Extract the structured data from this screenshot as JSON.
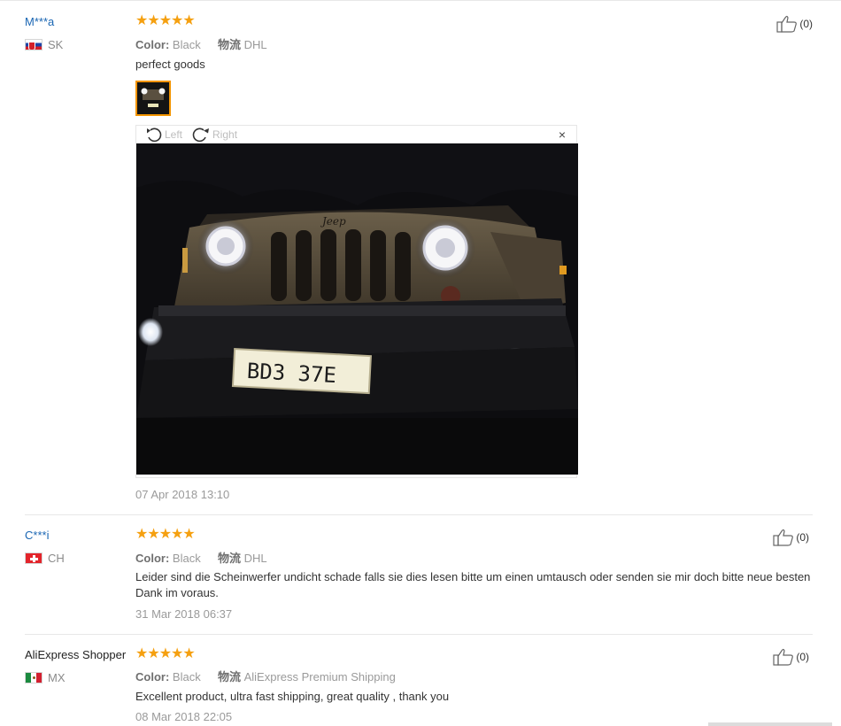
{
  "reviews": [
    {
      "name": "M***a",
      "country": "SK",
      "flag": "sk",
      "stars": "★★★★★",
      "color_label": "Color:",
      "color_value": "Black",
      "shipping_label": "物流",
      "shipping_value": "DHL",
      "text": "perfect goods",
      "date": "07 Apr 2018 13:10",
      "helpful": "(0)"
    },
    {
      "name": "C***i",
      "country": "CH",
      "flag": "ch",
      "stars": "★★★★★",
      "color_label": "Color:",
      "color_value": "Black",
      "shipping_label": "物流",
      "shipping_value": "DHL",
      "text": "Leider sind die Scheinwerfer undicht schade falls sie dies lesen bitte um einen umtausch oder senden sie mir doch bitte neue besten Dank im voraus.",
      "date": "31 Mar 2018 06:37",
      "helpful": "(0)"
    },
    {
      "name": "AliExpress Shopper",
      "country": "MX",
      "flag": "mx",
      "stars": "★★★★★",
      "color_label": "Color:",
      "color_value": "Black",
      "shipping_label": "物流",
      "shipping_value": "AliExpress Premium Shipping",
      "text": "Excellent product, ultra fast shipping, great quality , thank you",
      "date": "08 Mar 2018 22:05",
      "helpful": "(0)"
    }
  ],
  "viewer": {
    "rotate_left": "Left",
    "rotate_right": "Right",
    "close": "×",
    "plate_text": "BD3  37E",
    "grille_brand": "Jeep"
  },
  "colors": {
    "name_link": "#1a66b3",
    "stars": "#f5a010",
    "thumb_border": "#f29400",
    "divider": "#e8e8e8"
  }
}
